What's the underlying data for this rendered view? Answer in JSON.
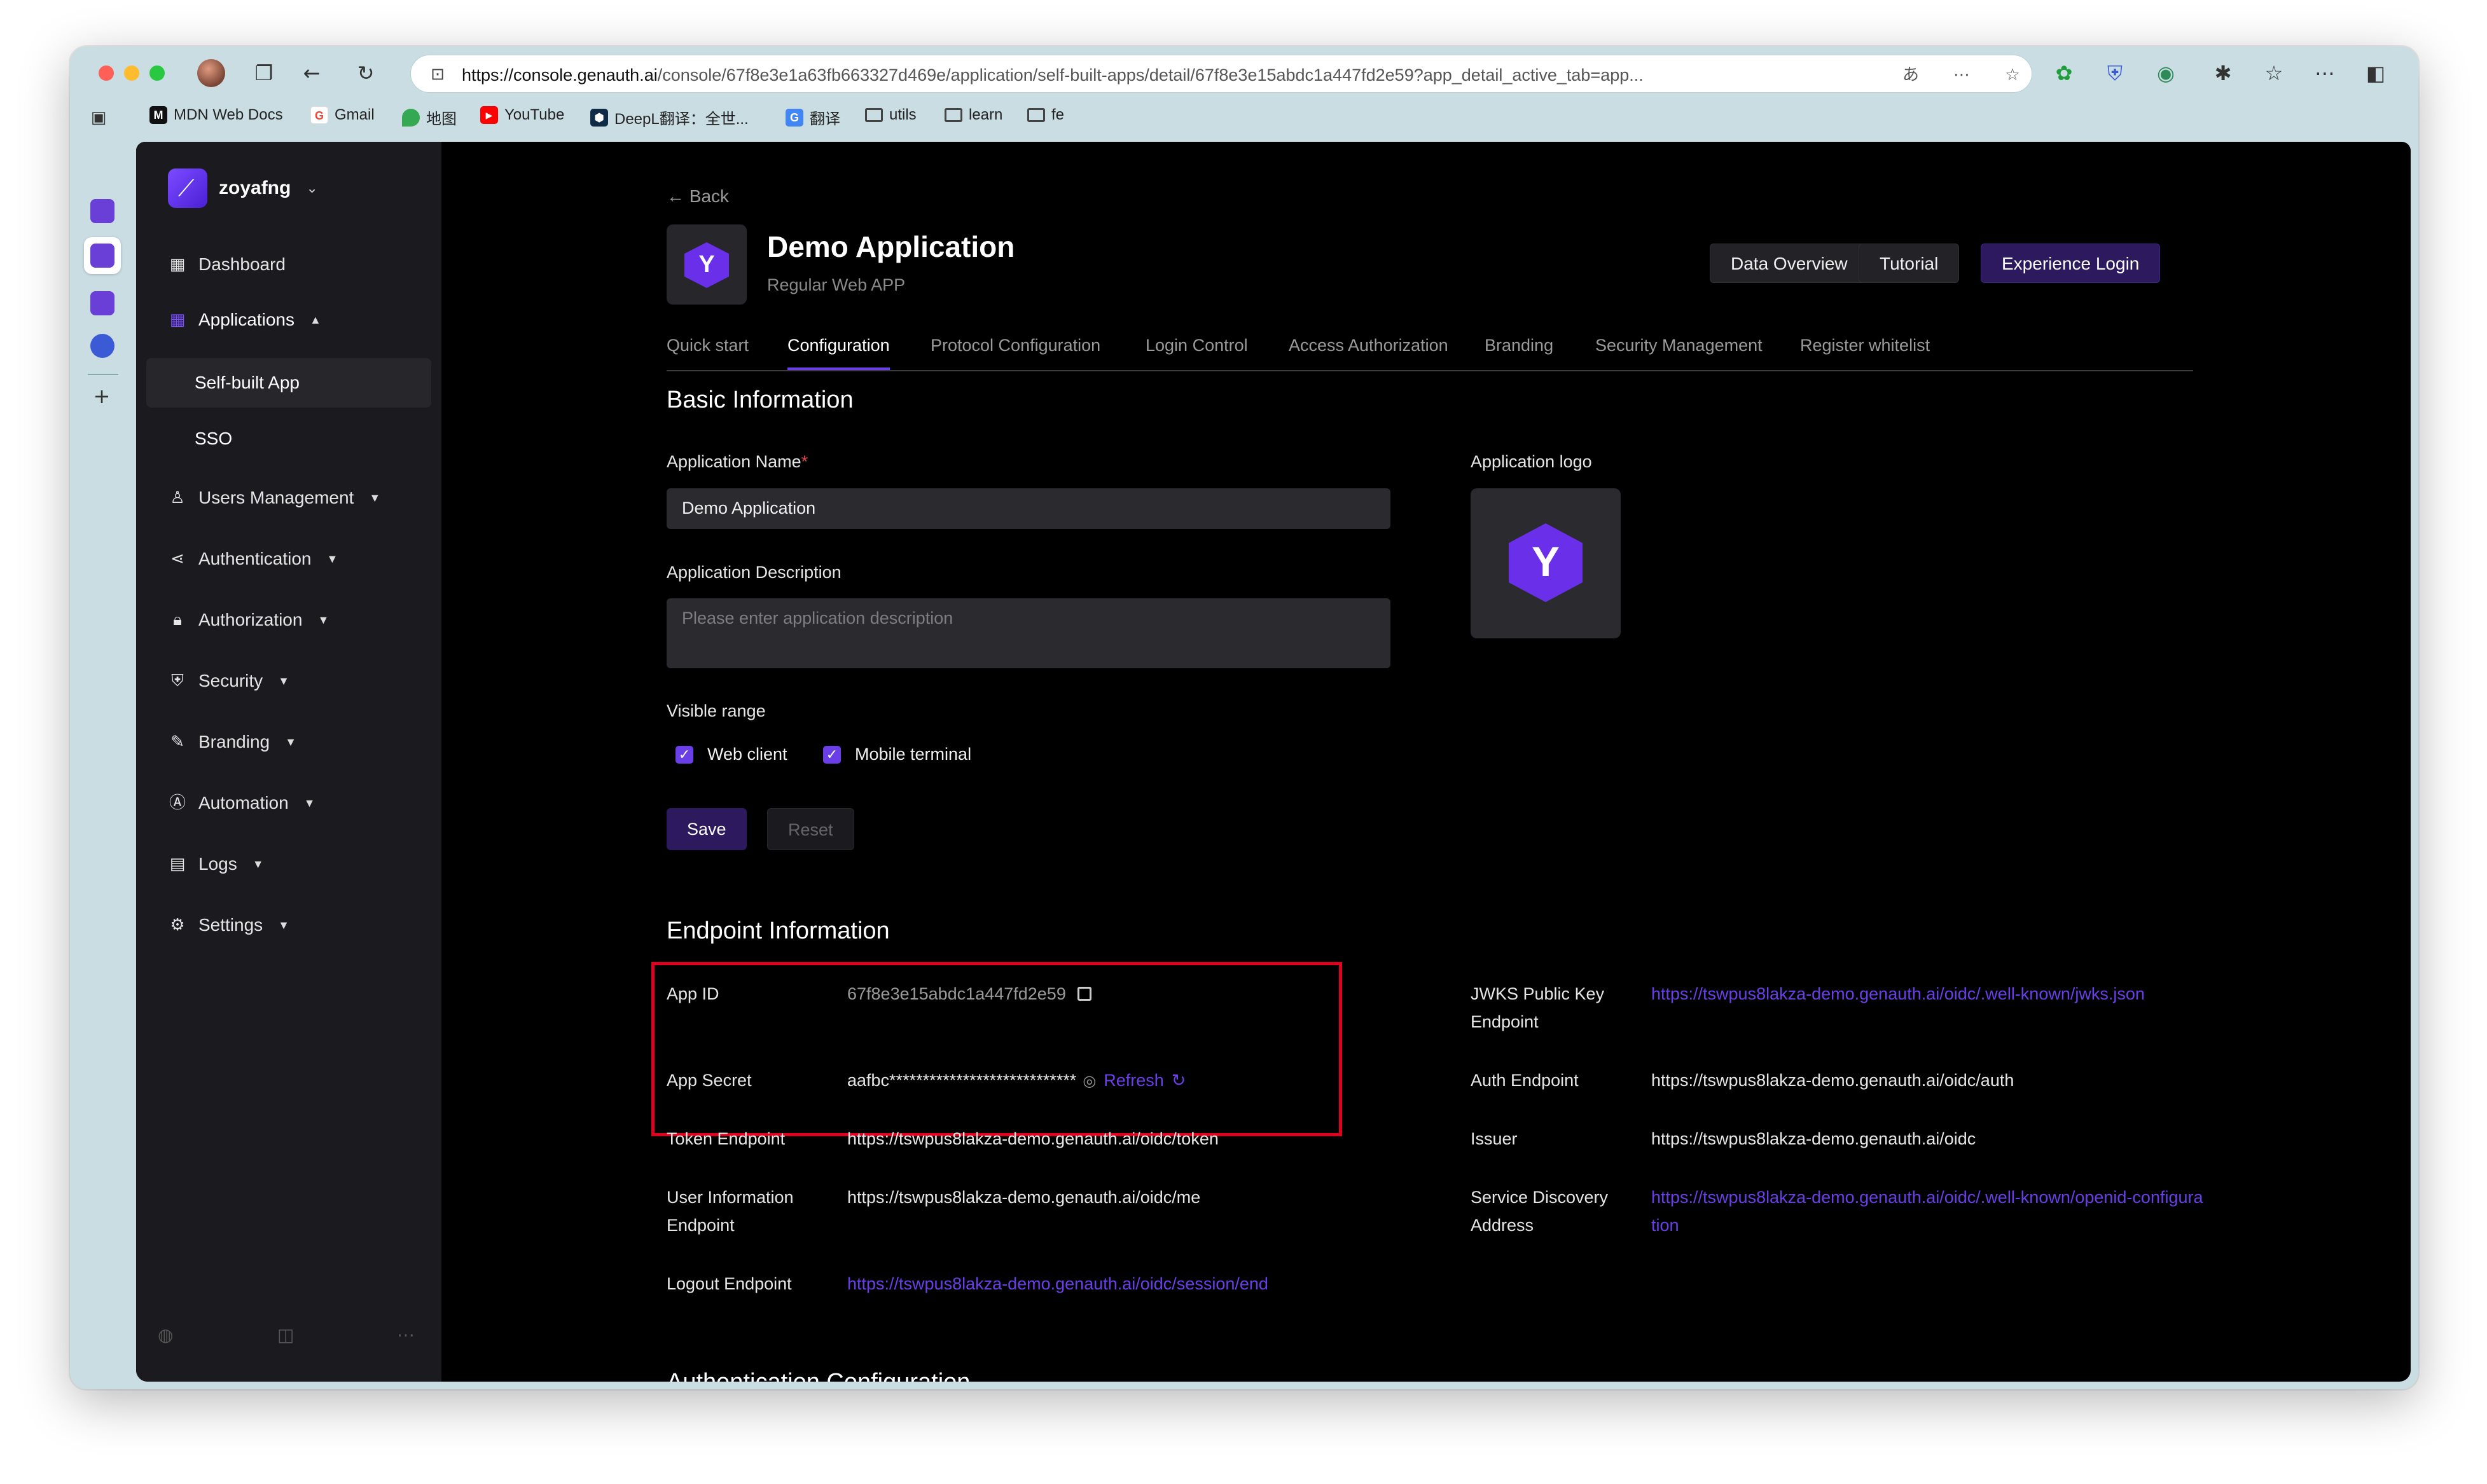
{
  "browser": {
    "url_host": "https://console.genauth.ai",
    "url_path": "/console/67f8e3e1a63fb663327d469e/application/self-built-apps/detail/67f8e3e15abdc1a447fd2e59?app_detail_active_tab=app...",
    "bookmarks": [
      {
        "label": "MDN Web Docs",
        "icon": "mdn-icon",
        "color": "#111111"
      },
      {
        "label": "Gmail",
        "icon": "google-icon",
        "color": "#ea4335"
      },
      {
        "label": "地图",
        "icon": "maps-pin-icon",
        "color": "#34a853"
      },
      {
        "label": "YouTube",
        "icon": "youtube-icon",
        "color": "#ff0000"
      },
      {
        "label": "DeepL翻译：全世...",
        "icon": "deepl-icon",
        "color": "#0f2b46"
      },
      {
        "label": "翻译",
        "icon": "translate-icon",
        "color": "#4285f4"
      },
      {
        "label": "utils",
        "icon": "folder-icon"
      },
      {
        "label": "learn",
        "icon": "folder-icon"
      },
      {
        "label": "fe",
        "icon": "folder-icon"
      }
    ]
  },
  "sidebar": {
    "org_name": "zoyafng",
    "items": [
      {
        "label": "Dashboard",
        "icon": "dashboard-icon"
      },
      {
        "label": "Applications",
        "icon": "apps-grid-icon"
      },
      {
        "label": "Self-built App"
      },
      {
        "label": "SSO"
      },
      {
        "label": "Users Management",
        "icon": "user-icon"
      },
      {
        "label": "Authentication",
        "icon": "share-nodes-icon"
      },
      {
        "label": "Authorization",
        "icon": "lock-icon"
      },
      {
        "label": "Security",
        "icon": "shield-icon"
      },
      {
        "label": "Branding",
        "icon": "brush-icon"
      },
      {
        "label": "Automation",
        "icon": "automation-icon"
      },
      {
        "label": "Logs",
        "icon": "logs-icon"
      },
      {
        "label": "Settings",
        "icon": "gear-icon"
      }
    ]
  },
  "header": {
    "back": "Back",
    "title": "Demo Application",
    "subtitle": "Regular Web APP",
    "buttons": {
      "data_overview": "Data Overview",
      "tutorial": "Tutorial",
      "experience_login": "Experience Login"
    }
  },
  "tabs": [
    "Quick start",
    "Configuration",
    "Protocol Configuration",
    "Login Control",
    "Access Authorization",
    "Branding",
    "Security Management",
    "Register whitelist"
  ],
  "basic": {
    "title": "Basic Information",
    "name_label": "Application Name",
    "name_required": "*",
    "name_value": "Demo Application",
    "desc_label": "Application Description",
    "desc_placeholder": "Please enter application description",
    "logo_label": "Application logo",
    "visible_label": "Visible range",
    "web_client": "Web client",
    "mobile_terminal": "Mobile terminal",
    "save": "Save",
    "reset": "Reset"
  },
  "endpoint": {
    "title": "Endpoint Information",
    "app_id_label": "App ID",
    "app_id": "67f8e3e15abdc1a447fd2e59",
    "app_secret_label": "App Secret",
    "app_secret": "aafbc****************************",
    "refresh": "Refresh",
    "token_label": "Token Endpoint",
    "token": "https://tswpus8lakza-demo.genauth.ai/oidc/token",
    "userinfo_label": "User Information Endpoint",
    "userinfo": "https://tswpus8lakza-demo.genauth.ai/oidc/me",
    "logout_label": "Logout Endpoint",
    "logout": "https://tswpus8lakza-demo.genauth.ai/oidc/session/end",
    "jwks_label": "JWKS Public Key Endpoint",
    "jwks": "https://tswpus8lakza-demo.genauth.ai/oidc/.well-known/jwks.json",
    "auth_label": "Auth Endpoint",
    "auth": "https://tswpus8lakza-demo.genauth.ai/oidc/auth",
    "issuer_label": "Issuer",
    "issuer": "https://tswpus8lakza-demo.genauth.ai/oidc",
    "discovery_label": "Service Discovery Address",
    "discovery": "https://tswpus8lakza-demo.genauth.ai/oidc/.well-known/openid-configuration"
  },
  "next_section_title": "Authentication Configuration",
  "colors": {
    "accent": "#6a3fe8",
    "highlight": "#e00020",
    "sidebar_bg": "#1b1b1f"
  }
}
